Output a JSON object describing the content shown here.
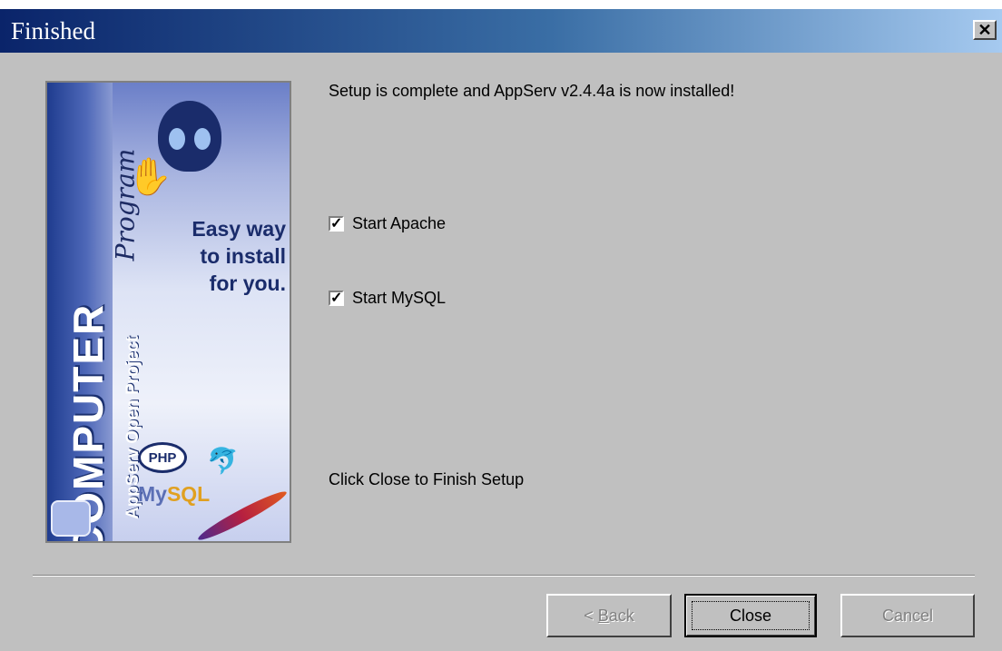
{
  "window": {
    "title": "Finished",
    "close_glyph": "✕"
  },
  "banner": {
    "computer_text": "COMPUTER",
    "program_text": "Program",
    "appserv_text": "AppServ Open Project",
    "tagline_line1": "Easy way",
    "tagline_line2": "to install",
    "tagline_line3": "for you.",
    "php_logo": "PHP",
    "mysql_my": "My",
    "mysql_sql": "SQL",
    "icons": [
      "alien-head-icon",
      "hand-icon",
      "dolphin-icon",
      "apache-feather-icon"
    ]
  },
  "content": {
    "status_message": "Setup is complete and AppServ v2.4.4a is now installed!",
    "options": [
      {
        "label": "Start Apache",
        "checked": true
      },
      {
        "label": "Start MySQL",
        "checked": true
      }
    ],
    "footer_hint": "Click Close to Finish Setup"
  },
  "buttons": {
    "back_prefix": "< ",
    "back_mnemonic": "B",
    "back_rest": "ack",
    "close": "Close",
    "cancel": "Cancel"
  },
  "colors": {
    "titlebar_start": "#0a246a",
    "titlebar_end": "#a6caf0",
    "dialog_bg": "#c0c0c0"
  }
}
